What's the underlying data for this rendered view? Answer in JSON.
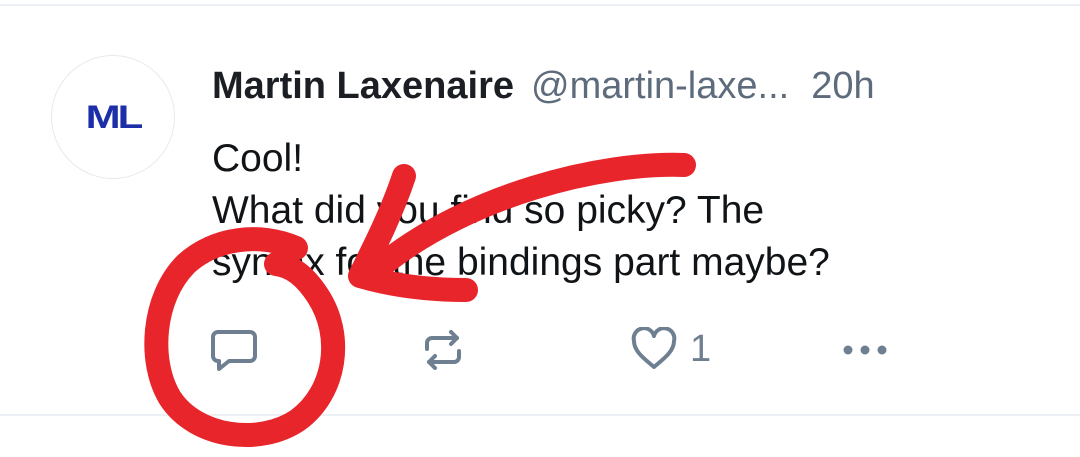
{
  "post": {
    "avatar_initials": "ML",
    "author_name": "Martin Laxenaire",
    "author_handle": "@martin-laxe...",
    "time_ago": "20h",
    "text_lines": [
      "Cool!",
      "What did you find so picky? The",
      "syntax for the bindings part maybe?"
    ]
  },
  "actions": {
    "reply_icon": "speech-bubble-icon",
    "repost_icon": "repost-arrows-icon",
    "like_icon": "heart-icon",
    "like_count": "1",
    "more_icon": "ellipsis-icon"
  },
  "colors": {
    "avatar_brand": "#1c2fa8",
    "name_text": "#1b1f24",
    "meta_text": "#5d6b7c",
    "icon": "#6f7f92",
    "annotation": "#e8252a",
    "divider": "#eceff3"
  }
}
